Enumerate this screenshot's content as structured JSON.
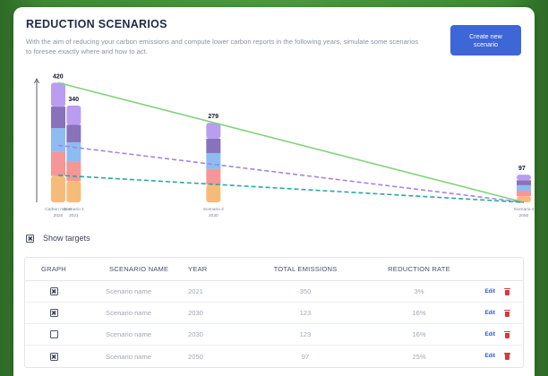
{
  "header": {
    "title": "REDUCTION SCENARIOS",
    "description": "With the aim of reducing your carbon emissions and compute lower carbon reports in the following years, simulate some scenarios to foresee exactly where and how to act.",
    "create_button_label": "Create new scenario"
  },
  "colors": {
    "accent": "#3d66d6",
    "target_line": "#7fd37a",
    "purple_dashed": "#a383e8",
    "teal_dashed": "#28a89e",
    "delete": "#d33a3a"
  },
  "chart_data": {
    "type": "bar",
    "stacked": true,
    "categories": [
      "Carbon report 2020",
      "Scenario 1 2021",
      "Scenario 2 2030",
      "Scenario 4 2050"
    ],
    "values": [
      420,
      340,
      279,
      97
    ],
    "x_years": [
      2020,
      2021,
      2030,
      2050
    ],
    "segment_colors": [
      "#f6b46a",
      "#f58b8b",
      "#7fb5f0",
      "#7b63b5",
      "#b292f0"
    ],
    "segment_fractions": [
      [
        0.22,
        0.2,
        0.2,
        0.18,
        0.2
      ],
      [
        0.22,
        0.2,
        0.2,
        0.18,
        0.2
      ],
      [
        0.22,
        0.2,
        0.2,
        0.18,
        0.2
      ],
      [
        0.22,
        0.2,
        0.2,
        0.18,
        0.2
      ]
    ],
    "lines": [
      {
        "style": "solid",
        "color": "#7fd37a",
        "from": [
          2020,
          420
        ],
        "to": [
          2050,
          0
        ]
      },
      {
        "style": "dashed",
        "color": "#a383e8",
        "from": [
          2020,
          200
        ],
        "to": [
          2050,
          0
        ]
      },
      {
        "style": "dashed",
        "color": "#28a89e",
        "from": [
          2020,
          95
        ],
        "to": [
          2050,
          0
        ]
      }
    ],
    "ylim": [
      0,
      440
    ],
    "grid": false
  },
  "show_targets": {
    "label": "Show targets",
    "checked": true
  },
  "table": {
    "headers": {
      "graph": "GRAPH",
      "name": "SCENARIO NAME",
      "year": "YEAR",
      "total": "TOTAL EMISSIONS",
      "rate": "REDUCTION RATE"
    },
    "rows": [
      {
        "checked": true,
        "name": "Scenario name",
        "year": "2021",
        "total": "350",
        "rate": "3%",
        "edit": "Edit"
      },
      {
        "checked": true,
        "name": "Scenario name",
        "year": "2030",
        "total": "123",
        "rate": "16%",
        "edit": "Edit"
      },
      {
        "checked": false,
        "name": "Scenario name",
        "year": "2030",
        "total": "123",
        "rate": "16%",
        "edit": "Edit"
      },
      {
        "checked": true,
        "name": "Scenario name",
        "year": "2050",
        "total": "97",
        "rate": "25%",
        "edit": "Edit"
      }
    ]
  }
}
